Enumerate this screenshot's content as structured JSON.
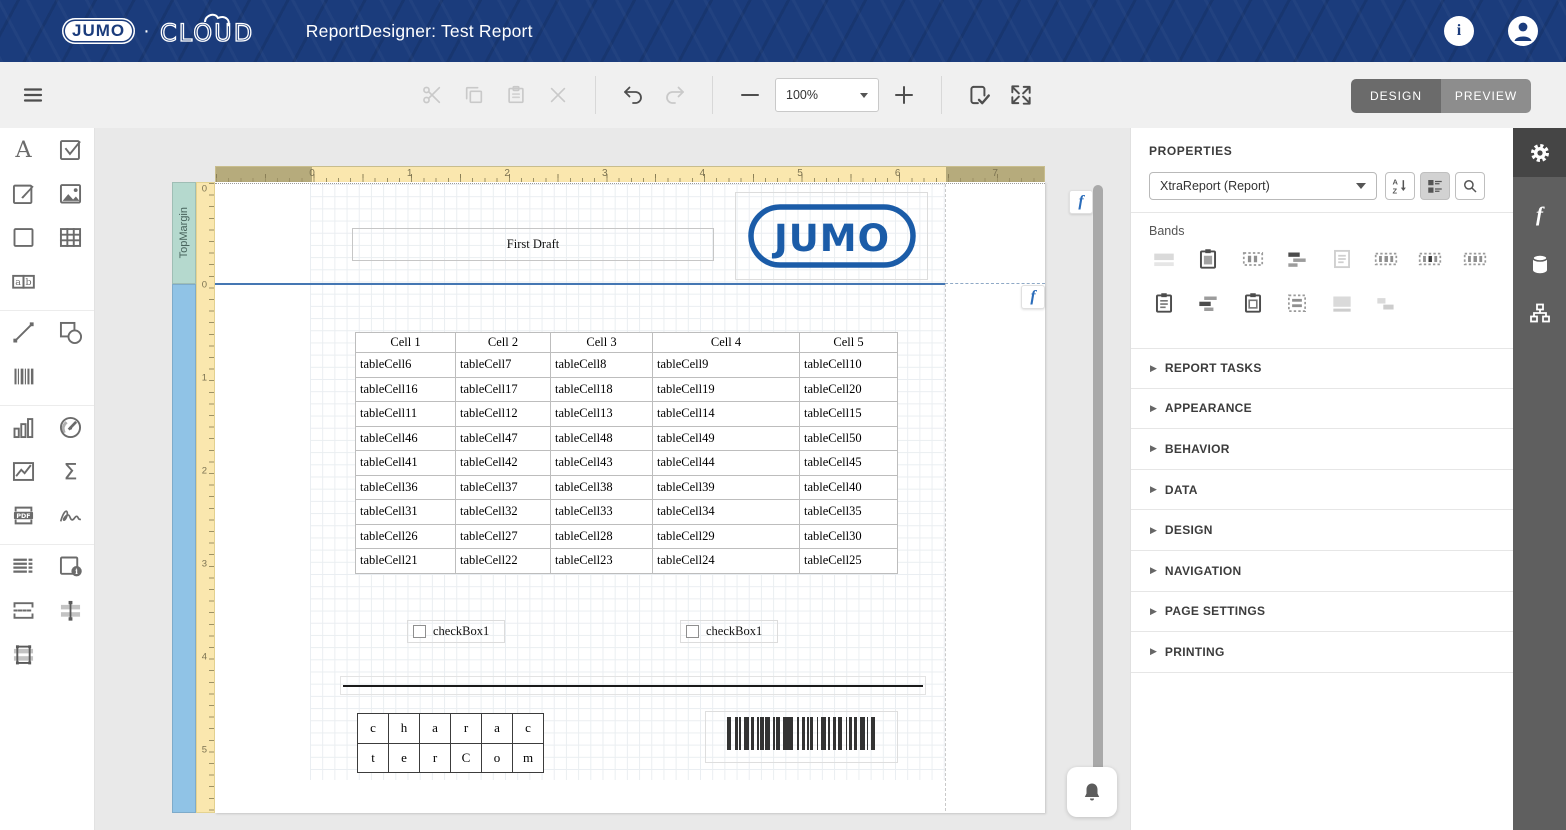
{
  "header": {
    "brand_jumo": "JUMO",
    "brand_dot": "·",
    "brand_cloud": "CLOUD",
    "title": "ReportDesigner: Test Report"
  },
  "toolbar": {
    "zoom_value": "100%",
    "design_label": "DESIGN",
    "preview_label": "PREVIEW"
  },
  "toolbox": {
    "groups": [
      [
        "label",
        "check-box",
        "rich-text",
        "picture-box",
        "panel",
        "table",
        "character-comb"
      ],
      [
        "line",
        "shape",
        "barcode"
      ],
      [
        "chart",
        "gauge",
        "sparkline",
        "pivot-grid",
        "pdf-content",
        "signature"
      ],
      [
        "table-of-contents",
        "page-info",
        "page-break",
        "cross-band-line",
        "cross-band-box"
      ]
    ]
  },
  "canvas": {
    "h_ruler_numbers": [
      "0",
      "1",
      "2",
      "3",
      "4",
      "5",
      "6",
      "7"
    ],
    "v_ruler_numbers": [
      "0",
      "0",
      "1",
      "2",
      "3",
      "4",
      "5"
    ],
    "top_margin_band_label": "TopMargin"
  },
  "report": {
    "title_label": "First Draft",
    "logo_text": "JUMO",
    "table": {
      "headers": [
        "Cell 1",
        "Cell 2",
        "Cell 3",
        "Cell 4",
        "Cell 5"
      ],
      "rows": [
        [
          "tableCell6",
          "tableCell7",
          "tableCell8",
          "tableCell9",
          "tableCell10"
        ],
        [
          "tableCell16",
          "tableCell17",
          "tableCell18",
          "tableCell19",
          "tableCell20"
        ],
        [
          "tableCell11",
          "tableCell12",
          "tableCell13",
          "tableCell14",
          "tableCell15"
        ],
        [
          "tableCell46",
          "tableCell47",
          "tableCell48",
          "tableCell49",
          "tableCell50"
        ],
        [
          "tableCell41",
          "tableCell42",
          "tableCell43",
          "tableCell44",
          "tableCell45"
        ],
        [
          "tableCell36",
          "tableCell37",
          "tableCell38",
          "tableCell39",
          "tableCell40"
        ],
        [
          "tableCell31",
          "tableCell32",
          "tableCell33",
          "tableCell34",
          "tableCell35"
        ],
        [
          "tableCell26",
          "tableCell27",
          "tableCell28",
          "tableCell29",
          "tableCell30"
        ],
        [
          "tableCell21",
          "tableCell22",
          "tableCell23",
          "tableCell24",
          "tableCell25"
        ]
      ]
    },
    "checkboxes": [
      {
        "label": "checkBox1",
        "checked": false
      },
      {
        "label": "checkBox1",
        "checked": false
      }
    ],
    "character_comb": {
      "rows": [
        [
          "c",
          "h",
          "a",
          "r",
          "a",
          "c"
        ],
        [
          "t",
          "e",
          "r",
          "C",
          "o",
          "m"
        ]
      ]
    },
    "barcode": {
      "pattern": [
        3,
        2,
        2,
        1,
        1,
        2,
        3,
        1,
        2,
        2,
        1,
        1,
        2,
        1,
        3,
        2,
        1,
        1,
        2,
        2,
        6,
        3,
        1,
        2,
        2,
        1,
        1,
        1,
        2,
        2,
        1,
        2,
        3,
        1,
        1,
        2,
        2,
        1,
        3,
        2,
        1,
        1,
        2,
        1,
        2,
        2,
        3,
        1,
        1,
        2,
        2,
        1
      ]
    }
  },
  "properties": {
    "title": "PROPERTIES",
    "selector_value": "XtraReport (Report)",
    "bands_label": "Bands",
    "bands_row1": [
      {
        "name": "top-margin",
        "style": "bar-light"
      },
      {
        "name": "report-header",
        "style": "clipboard-dark"
      },
      {
        "name": "page-header",
        "style": "dashed-cols-mid"
      },
      {
        "name": "group-header",
        "style": "rows-offset-dark"
      },
      {
        "name": "detail",
        "style": "doc-light"
      },
      {
        "name": "detail-report",
        "style": "dashed-cols-wide"
      },
      {
        "name": "vertical-header",
        "style": "dashed-cols-wide-dark"
      },
      {
        "name": "vertical-detail",
        "style": "dashed-cols-wide"
      }
    ],
    "bands_row2": [
      {
        "name": "report-footer",
        "style": "clipboard-lines"
      },
      {
        "name": "group-footer",
        "style": "rows-offset-mid"
      },
      {
        "name": "page-footer",
        "style": "clipboard-inner"
      },
      {
        "name": "vertical-total",
        "style": "dashed-rows-mid"
      },
      {
        "name": "bottom-margin",
        "style": "box-light"
      },
      {
        "name": "sub-band",
        "style": "steps-light"
      }
    ],
    "sections": [
      "REPORT TASKS",
      "APPEARANCE",
      "BEHAVIOR",
      "DATA",
      "DESIGN",
      "NAVIGATION",
      "PAGE SETTINGS",
      "PRINTING"
    ]
  },
  "colors": {
    "header_navy": "#1b3c7c",
    "logo_blue": "#1b5ca8",
    "band_separator_blue": "#4577b3",
    "top_margin_band": "#b5d9ce",
    "detail_band": "#90c3e6",
    "ruler_yellow": "#fae7ae",
    "ruler_margin_tan": "#b6ab7c"
  }
}
